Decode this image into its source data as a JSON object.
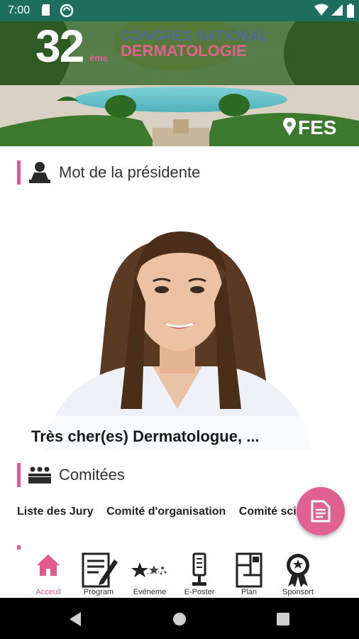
{
  "status_bar": {
    "time": "7:00",
    "bg_color": "#1e6e60"
  },
  "banner": {
    "number": "32",
    "suffix": "ème",
    "line1": "CONGRES NATIONAL",
    "line2": "DERMATOLOGIE",
    "location": "FES"
  },
  "president_section": {
    "title": "Mot de la présidente",
    "caption": "Très cher(es) Dermatologue, ..."
  },
  "committees_section": {
    "title": "Comitées",
    "items": [
      "Liste des Jury",
      "Comité d'organisation",
      "Comité scie"
    ]
  },
  "bottom_nav": {
    "items": [
      {
        "label": "Acceuil",
        "icon": "home-icon",
        "active": true
      },
      {
        "label": "Program",
        "icon": "program-icon",
        "active": false
      },
      {
        "label": "Evéneme",
        "icon": "events-icon",
        "active": false
      },
      {
        "label": "E-Poster",
        "icon": "eposter-icon",
        "active": false
      },
      {
        "label": "Plan",
        "icon": "plan-icon",
        "active": false
      },
      {
        "label": "Sponsort",
        "icon": "sponsor-icon",
        "active": false
      }
    ]
  },
  "colors": {
    "accent": "#e05a8a",
    "status_bar": "#1e6e60"
  }
}
